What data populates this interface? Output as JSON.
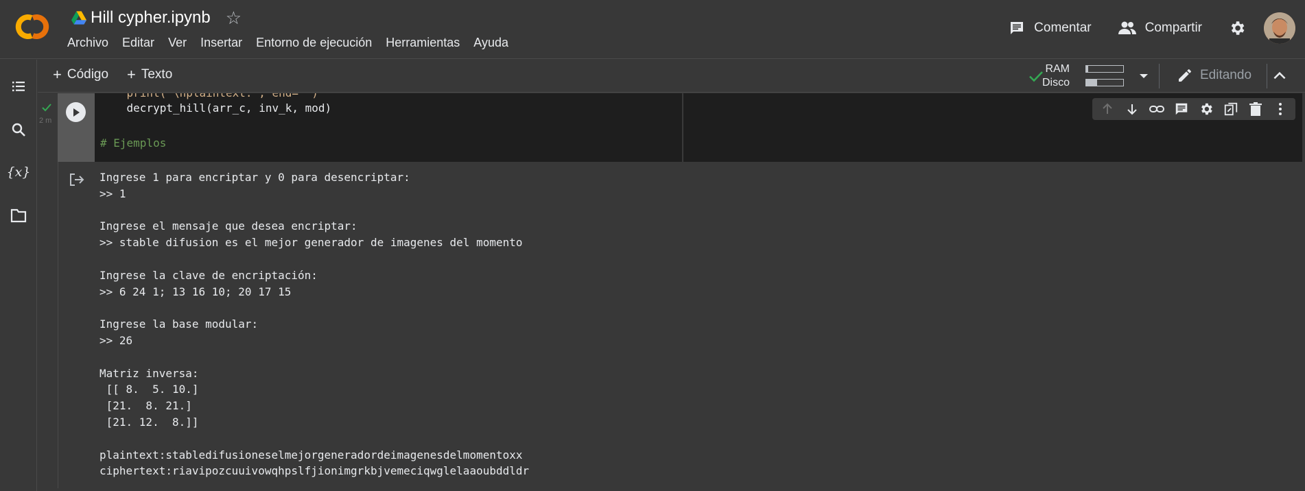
{
  "header": {
    "doc_title": "Hill cypher.ipynb",
    "menu": [
      "Archivo",
      "Editar",
      "Ver",
      "Insertar",
      "Entorno de ejecución",
      "Herramientas",
      "Ayuda"
    ],
    "comment_label": "Comentar",
    "share_label": "Compartir"
  },
  "toolbar": {
    "add_code_label": "Código",
    "add_text_label": "Texto",
    "ram_label": "RAM",
    "disk_label": "Disco",
    "ram_usage": 0.06,
    "disk_usage": 0.3,
    "editing_label": "Editando"
  },
  "cell": {
    "exec_time": "2 m",
    "code_lines": [
      "    print(\"\\nplaintext:\", end=\"\")",
      "    decrypt_hill(arr_c, inv_k, mod)",
      "",
      "# Ejemplos"
    ]
  },
  "output": {
    "text": "Ingrese 1 para encriptar y 0 para desencriptar:\n>> 1\n\nIngrese el mensaje que desea encriptar:\n>> stable difusion es el mejor generador de imagenes del momento\n\nIngrese la clave de encriptación:\n>> 6 24 1; 13 16 10; 20 17 15\n\nIngrese la base modular:\n>> 26\n\nMatriz inversa:\n [[ 8.  5. 10.]\n [21.  8. 21.]\n [21. 12.  8.]]\n\nplaintext:stabledifusioneselmejorgeneradordeimagenesdelmomentoxx\nciphertext:riavipozcuuivowqhpslfjionimgrkbjvemeciqwglelaaoubddldr"
  },
  "colors": {
    "accent_orange": "#f9ab00",
    "success_green": "#34a853",
    "comment_green": "#6a9955",
    "bg": "#383838",
    "code_bg": "#1e1e1e"
  },
  "icons": {
    "logo": "colab-logo",
    "drive": "google-drive-icon",
    "star": "star-icon",
    "comment": "comment-icon",
    "share": "people-icon",
    "settings": "gear-icon",
    "toc": "toc-icon",
    "search": "search-icon",
    "variables": "variables-icon",
    "files": "folder-icon",
    "run": "run-cell-icon",
    "output": "output-icon"
  }
}
